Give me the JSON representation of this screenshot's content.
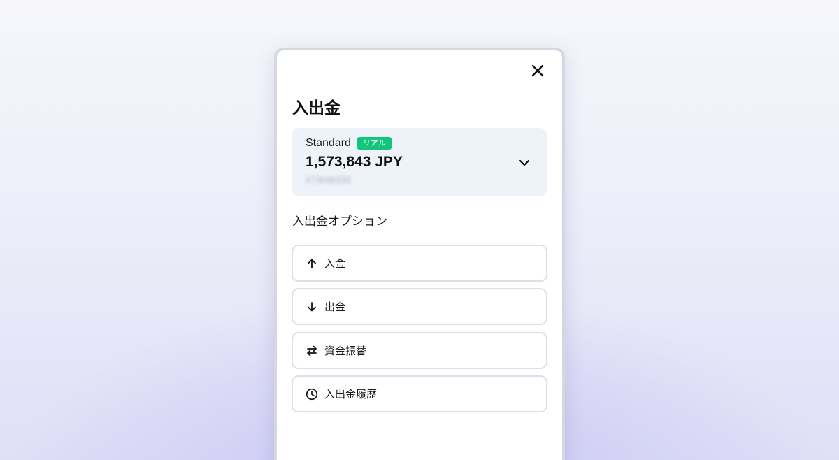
{
  "dialog": {
    "title": "入出金",
    "close_icon": "close-icon"
  },
  "account": {
    "name": "Standard",
    "badge": "リアル",
    "badge_color": "#13c57b",
    "balance": "1,573,843 JPY",
    "id": "#73036335",
    "expand_icon": "chevron-down-icon"
  },
  "options_section": {
    "title": "入出金オプション",
    "items": [
      {
        "label": "入金",
        "icon": "arrow-up-icon"
      },
      {
        "label": "出金",
        "icon": "arrow-down-icon"
      },
      {
        "label": "資金振替",
        "icon": "transfer-arrows-icon"
      },
      {
        "label": "入出金履歴",
        "icon": "clock-icon"
      }
    ]
  }
}
